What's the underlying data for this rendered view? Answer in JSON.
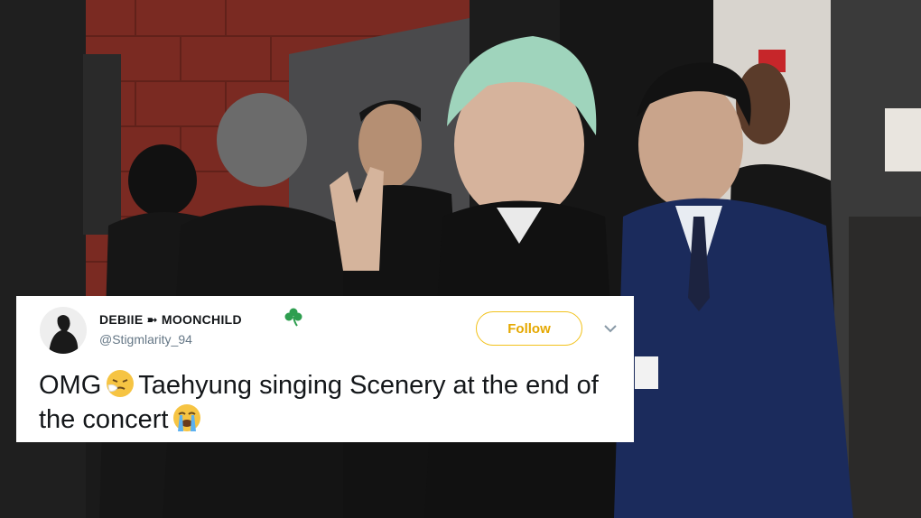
{
  "photo": {
    "description_icon": "backstage-photo"
  },
  "tweet": {
    "display_name": "DEBIIE ➼ MOONCHILD",
    "handle": "@Stigmlarity_94",
    "follow_label": "Follow",
    "text_part1": "OMG",
    "text_part2": "Taehyung singing Scenery at the end of the concert",
    "emoji_1": "sneezing-face-emoji",
    "emoji_2": "loudly-crying-face-emoji",
    "name_emoji": "shamrock-emoji",
    "accent_color": "#f2c21b"
  }
}
